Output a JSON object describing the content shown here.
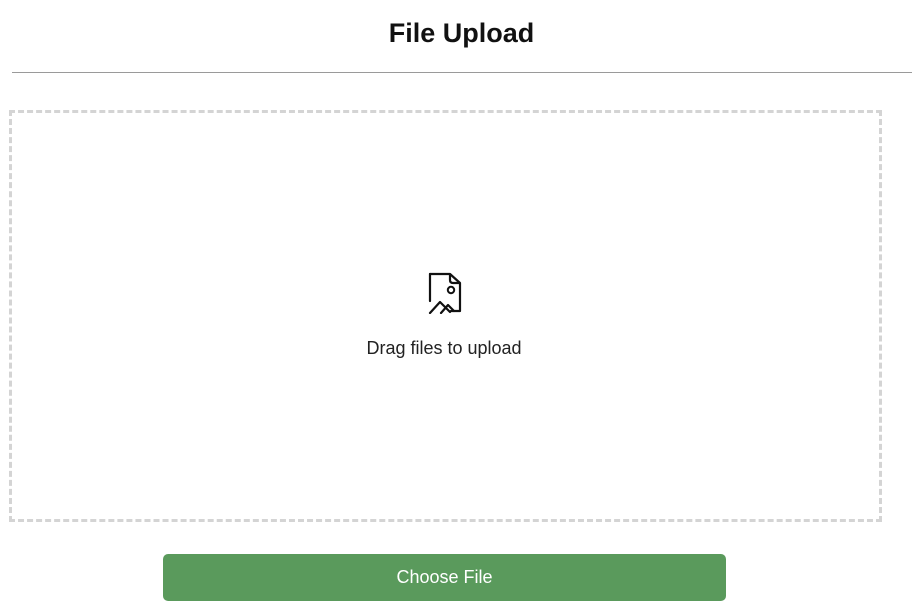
{
  "page": {
    "title": "File Upload"
  },
  "dropzone": {
    "icon": "image-file-icon",
    "text": "Drag files to upload"
  },
  "actions": {
    "choose_file_label": "Choose File"
  },
  "colors": {
    "button_background": "#5a9a5c",
    "button_text": "#ffffff",
    "dropzone_border": "#d4d4d4",
    "divider": "#9a9a9a"
  }
}
